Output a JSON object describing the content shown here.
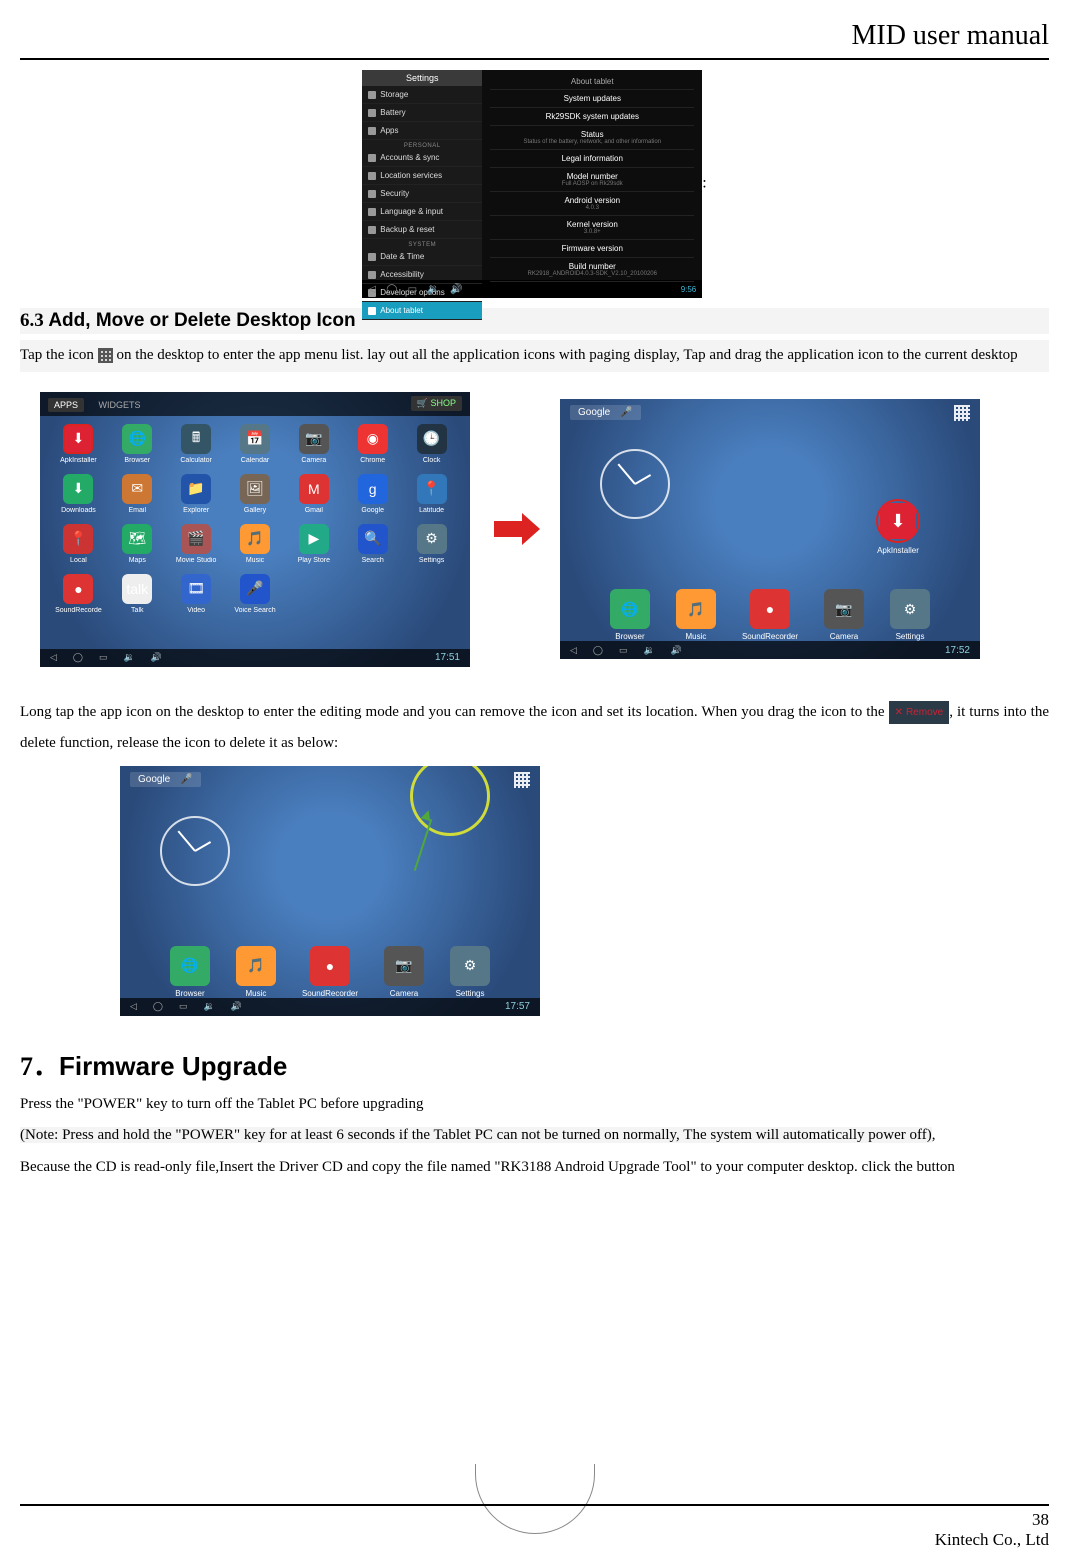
{
  "header": {
    "title": "MID user manual"
  },
  "footer": {
    "page_number": "38",
    "company": "Kintech Co., Ltd"
  },
  "settings_screenshot": {
    "title": "Settings",
    "time": "9:56",
    "sidebar": {
      "items_top": [
        {
          "label": "Storage"
        },
        {
          "label": "Battery"
        },
        {
          "label": "Apps"
        }
      ],
      "cat_personal": "PERSONAL",
      "items_personal": [
        {
          "label": "Accounts & sync"
        },
        {
          "label": "Location services"
        },
        {
          "label": "Security"
        },
        {
          "label": "Language & input"
        },
        {
          "label": "Backup & reset"
        }
      ],
      "cat_system": "SYSTEM",
      "items_system": [
        {
          "label": "Date & Time"
        },
        {
          "label": "Accessibility"
        },
        {
          "label": "Developer options"
        },
        {
          "label": "About tablet"
        }
      ]
    },
    "panel": {
      "header": "About tablet",
      "rows": [
        {
          "t": "System updates"
        },
        {
          "t": "Rk29SDK system updates"
        },
        {
          "t": "Status",
          "s": "Status of the battery, network, and other information"
        },
        {
          "t": "Legal information"
        },
        {
          "t": "Model number",
          "s": "Full AOSP on Rk29sdk"
        },
        {
          "t": "Android version",
          "s": "4.0.3"
        },
        {
          "t": "Kernel version",
          "s": "3.0.8+"
        },
        {
          "t": "Firmware version"
        },
        {
          "t": "Build number",
          "s": "RK2918_ANDROID4.0.3-SDK_V2.10_20100206"
        }
      ]
    }
  },
  "section_63": {
    "number": "6.3",
    "title": "Add, Move or Delete Desktop Icon",
    "text_before_icon": "Tap the icon ",
    "text_after_icon": " on the desktop to enter the app menu list.    lay out all the application icons with paging display, Tap and drag the application icon to the current desktop",
    "para2_before": "Long tap the app icon on the desktop to enter the editing mode and you can remove the icon and set its location. When you drag the icon to the ",
    "remove_label": "Remove",
    "para2_after": ", it turns into the delete function, release the icon to delete it as below:"
  },
  "apps_screenshot": {
    "tab_apps": "APPS",
    "tab_widgets": "WIDGETS",
    "shop": "SHOP",
    "time": "17:51",
    "apps": [
      {
        "n": "ApkInstaller",
        "c": "#d23",
        "g": "⬇"
      },
      {
        "n": "Browser",
        "c": "#3a6",
        "g": "🌐"
      },
      {
        "n": "Calculator",
        "c": "#356",
        "g": "🖩"
      },
      {
        "n": "Calendar",
        "c": "#578",
        "g": "📅"
      },
      {
        "n": "Camera",
        "c": "#555",
        "g": "📷"
      },
      {
        "n": "Chrome",
        "c": "#e33",
        "g": "◉"
      },
      {
        "n": "Clock",
        "c": "#234",
        "g": "🕒"
      },
      {
        "n": "Downloads",
        "c": "#2a6",
        "g": "⬇"
      },
      {
        "n": "Email",
        "c": "#c73",
        "g": "✉"
      },
      {
        "n": "Explorer",
        "c": "#25a",
        "g": "📁"
      },
      {
        "n": "Gallery",
        "c": "#765",
        "g": "🖼"
      },
      {
        "n": "Gmail",
        "c": "#d33",
        "g": "M"
      },
      {
        "n": "Google",
        "c": "#26d",
        "g": "g"
      },
      {
        "n": "Latitude",
        "c": "#37b",
        "g": "📍"
      },
      {
        "n": "Local",
        "c": "#c33",
        "g": "📍"
      },
      {
        "n": "Maps",
        "c": "#2a6",
        "g": "🗺"
      },
      {
        "n": "Movie Studio",
        "c": "#a55",
        "g": "🎬"
      },
      {
        "n": "Music",
        "c": "#f93",
        "g": "🎵"
      },
      {
        "n": "Play Store",
        "c": "#2a8",
        "g": "▶"
      },
      {
        "n": "Search",
        "c": "#25c",
        "g": "🔍"
      },
      {
        "n": "Settings",
        "c": "#578",
        "g": "⚙"
      },
      {
        "n": "SoundRecorde",
        "c": "#d33",
        "g": "●"
      },
      {
        "n": "Talk",
        "c": "#eee",
        "g": "talk"
      },
      {
        "n": "Video",
        "c": "#36c",
        "g": "🎞"
      },
      {
        "n": "Voice Search",
        "c": "#25c",
        "g": "🎤"
      }
    ]
  },
  "home_screenshot": {
    "search": "Google",
    "time": "17:52",
    "drop_app": "ApkInstaller",
    "dock": [
      {
        "n": "Browser",
        "c": "#3a6",
        "g": "🌐"
      },
      {
        "n": "Music",
        "c": "#f93",
        "g": "🎵"
      },
      {
        "n": "SoundRecorder",
        "c": "#d33",
        "g": "●"
      },
      {
        "n": "Camera",
        "c": "#555",
        "g": "📷"
      },
      {
        "n": "Settings",
        "c": "#578",
        "g": "⚙"
      }
    ]
  },
  "remove_screenshot": {
    "time": "17:57",
    "dock": [
      {
        "n": "Browser",
        "c": "#3a6",
        "g": "🌐"
      },
      {
        "n": "Music",
        "c": "#f93",
        "g": "🎵"
      },
      {
        "n": "SoundRecorder",
        "c": "#d33",
        "g": "●"
      },
      {
        "n": "Camera",
        "c": "#555",
        "g": "📷"
      },
      {
        "n": "Settings",
        "c": "#578",
        "g": "⚙"
      }
    ]
  },
  "chapter7": {
    "number": "7",
    "title": "Firmware Upgrade",
    "p1": "Press the \"POWER\" key to turn off the Tablet PC before upgrading",
    "p2a": "(Note: Press and hold the \"POWER\" key for at least 6 seconds if the Tablet PC can not be turned on normally, The system will automatically power off)",
    "p2b": ",",
    "p3": "Because the CD is read-only file,Insert the Driver CD and copy the file named \"RK3188 Android Upgrade Tool\" to your computer desktop. click the button"
  }
}
